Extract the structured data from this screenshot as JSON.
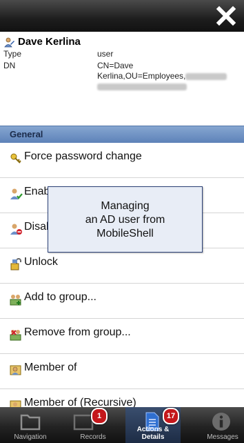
{
  "colors": {
    "topbar": "#1e1e1e",
    "section_header": "#6d8fc4",
    "badge": "#c4171b",
    "active_tab": "#2a3b58",
    "tooltip_border": "#2a3f75"
  },
  "topbar": {
    "close_icon": "close-x-icon"
  },
  "user": {
    "name": "Dave Kerlina",
    "icon": "user-edit-icon",
    "type_label": "Type",
    "type_value": "user",
    "dn_label": "DN",
    "dn_value_line1": "CN=Dave",
    "dn_value_line2": "Kerlina,OU=Employees,"
  },
  "section": {
    "title": "General"
  },
  "actions": [
    {
      "label": "Force password change",
      "icon": "key-icon"
    },
    {
      "label": "Enable",
      "icon": "user-check-icon"
    },
    {
      "label": "Disable",
      "icon": "user-disable-icon"
    },
    {
      "label": "Unlock",
      "icon": "unlock-icon"
    },
    {
      "label": "Add to group...",
      "icon": "group-add-icon"
    },
    {
      "label": "Remove from group...",
      "icon": "group-remove-icon"
    },
    {
      "label": "Member of",
      "icon": "group-icon"
    },
    {
      "label": "Member of (Recursive)",
      "icon": "group-recursive-icon"
    }
  ],
  "tooltip": {
    "text": "Managing\nan AD user from\nMobileShell"
  },
  "tabs": [
    {
      "label": "Navigation",
      "icon": "folder-icon"
    },
    {
      "label": "Records",
      "icon": "records-icon",
      "badge": "1"
    },
    {
      "label": "Actions & Details",
      "icon": "document-icon",
      "badge": "17",
      "active": true
    },
    {
      "label": "Messages",
      "icon": "info-icon"
    }
  ]
}
